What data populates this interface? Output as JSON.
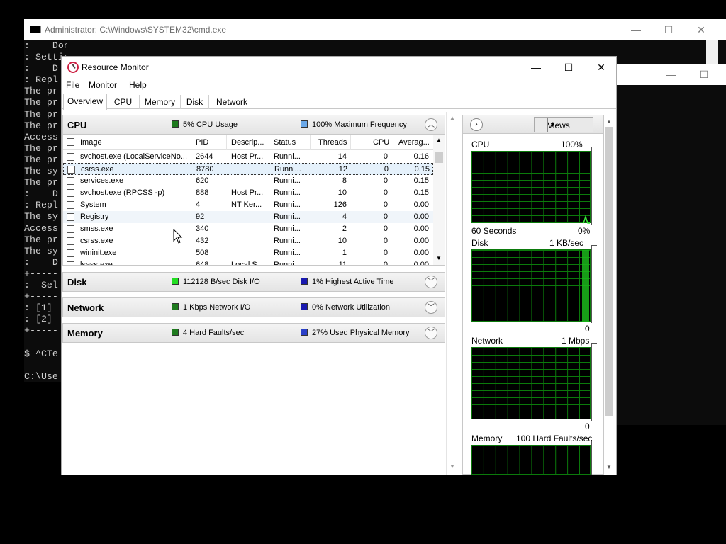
{
  "cmd": {
    "title": "Administrator: C:\\Windows\\SYSTEM32\\cmd.exe",
    "lines": [
      ":    Done.             :",
      ": Setting default all",
      ":    D",
      ": Repl",
      "The pr",
      "The pr",
      "The pr",
      "The pr",
      "Access",
      "The pr",
      "The pr",
      "The sy",
      "The pr",
      ":    D",
      ": Repl",
      "The sy",
      "Access",
      "The pr",
      "The sy",
      ":    D",
      "+-----",
      ":  Sel",
      "+-----",
      ": [1] ",
      ": [2] ",
      "+-----",
      "",
      "$ ^CTe",
      "",
      "C:\\Use"
    ]
  },
  "rm": {
    "title": "Resource Monitor",
    "menu": [
      "File",
      "Monitor",
      "Help"
    ],
    "tabs": [
      "Overview",
      "CPU",
      "Memory",
      "Disk",
      "Network"
    ],
    "active_tab": "Overview",
    "sections": {
      "cpu": {
        "name": "CPU",
        "metric1": "5% CPU Usage",
        "metric1_color": "#1e7a1e",
        "metric2": "100% Maximum Frequency",
        "metric2_color": "#6aa8e8"
      },
      "disk": {
        "name": "Disk",
        "metric1": "112128 B/sec Disk I/O",
        "metric1_color": "#22dd22",
        "metric2": "1% Highest Active Time",
        "metric2_color": "#1a1ab0"
      },
      "network": {
        "name": "Network",
        "metric1": "1 Kbps Network I/O",
        "metric1_color": "#1e7a1e",
        "metric2": "0% Network Utilization",
        "metric2_color": "#1a1ab0"
      },
      "memory": {
        "name": "Memory",
        "metric1": "4 Hard Faults/sec",
        "metric1_color": "#1e7a1e",
        "metric2": "27% Used Physical Memory",
        "metric2_color": "#2a40c8"
      }
    },
    "table": {
      "headers": [
        "Image",
        "PID",
        "Descrip...",
        "Status",
        "Threads",
        "CPU",
        "Averag..."
      ],
      "rows": [
        [
          "svchost.exe (LocalServiceNo...",
          "2644",
          "Host Pr...",
          "Runni...",
          "14",
          "0",
          "0.16"
        ],
        [
          "csrss.exe",
          "8780",
          "",
          "Runni...",
          "12",
          "0",
          "0.15"
        ],
        [
          "services.exe",
          "620",
          "",
          "Runni...",
          "8",
          "0",
          "0.15"
        ],
        [
          "svchost.exe (RPCSS -p)",
          "888",
          "Host Pr...",
          "Runni...",
          "10",
          "0",
          "0.15"
        ],
        [
          "System",
          "4",
          "NT Ker...",
          "Runni...",
          "126",
          "0",
          "0.00"
        ],
        [
          "Registry",
          "92",
          "",
          "Runni...",
          "4",
          "0",
          "0.00"
        ],
        [
          "smss.exe",
          "340",
          "",
          "Runni...",
          "2",
          "0",
          "0.00"
        ],
        [
          "csrss.exe",
          "432",
          "",
          "Runni...",
          "10",
          "0",
          "0.00"
        ],
        [
          "wininit.exe",
          "508",
          "",
          "Runni...",
          "1",
          "0",
          "0.00"
        ],
        [
          "lsass.exe",
          "648",
          "Local S...",
          "Runni...",
          "11",
          "0",
          "0.00"
        ]
      ]
    },
    "right": {
      "views_label": "Views",
      "graphs": [
        {
          "name": "CPU",
          "top_right": "100%",
          "bottom_left": "60 Seconds",
          "bottom_right": "0%"
        },
        {
          "name": "Disk",
          "top_right": "1 KB/sec",
          "bottom_left": "",
          "bottom_right": "0"
        },
        {
          "name": "Network",
          "top_right": "1 Mbps",
          "bottom_left": "",
          "bottom_right": "0"
        },
        {
          "name": "Memory",
          "top_right": "100 Hard Faults/sec",
          "bottom_left": "",
          "bottom_right": ""
        }
      ]
    }
  }
}
